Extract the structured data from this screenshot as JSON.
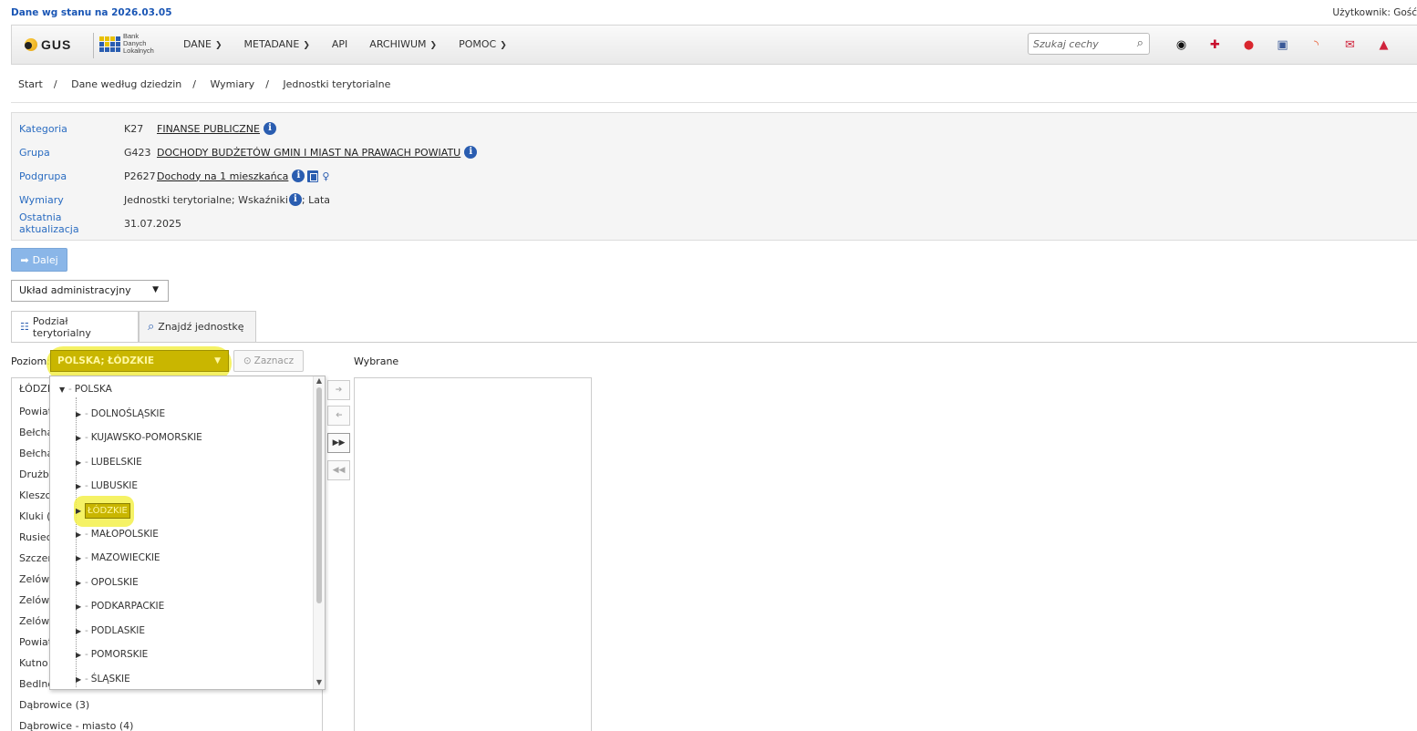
{
  "topbar": {
    "date_text": "Dane wg stanu na 2026.03.05",
    "user_text": "Użytkownik: Gość"
  },
  "logo": {
    "gus": "GUS",
    "bdl_lines": [
      "Bank",
      "Danych",
      "Lokalnych"
    ]
  },
  "nav": {
    "menu": [
      {
        "label": "DANE",
        "dropdown": true
      },
      {
        "label": "METADANE",
        "dropdown": true
      },
      {
        "label": "API",
        "dropdown": false
      },
      {
        "label": "ARCHIWUM",
        "dropdown": true
      },
      {
        "label": "POMOC",
        "dropdown": true
      }
    ],
    "search_placeholder": "Szukaj cechy",
    "icons": [
      "eye-icon",
      "flag-uk-icon",
      "chat-icon",
      "facebook-icon",
      "rss-icon",
      "mail-icon",
      "lock-icon"
    ],
    "icon_colors": [
      "#111111",
      "#c8102e",
      "#d9262e",
      "#3b5998",
      "#e8562a",
      "#d0233c",
      "#d0233c"
    ]
  },
  "breadcrumb": [
    "Start",
    "Dane według dziedzin",
    "Wymiary",
    "Jednostki terytorialne"
  ],
  "info": {
    "kategoria": {
      "label": "Kategoria",
      "code": "K27",
      "value": "FINANSE PUBLICZNE"
    },
    "grupa": {
      "label": "Grupa",
      "code": "G423",
      "value": "DOCHODY BUDŻETÓW GMIN I MIAST NA PRAWACH POWIATU"
    },
    "podgrupa": {
      "label": "Podgrupa",
      "code": "P2627",
      "value": "Dochody na 1 mieszkańca"
    },
    "wymiary": {
      "label": "Wymiary",
      "value_before": "Jednostki terytorialne; Wskaźniki",
      "value_after": "; Lata"
    },
    "aktualizacja": {
      "label": "Ostatnia aktualizacja",
      "value": "31.07.2025"
    }
  },
  "actions": {
    "dalej_label": "Dalej",
    "uklad_select": "Układ administracyjny"
  },
  "tabs": [
    {
      "label": "Podział terytorialny",
      "active": true
    },
    {
      "label": "Znajdź jednostkę",
      "active": false
    }
  ],
  "poziom": {
    "label": "Poziom:",
    "value": "POLSKA; ŁÓDZKIE",
    "zaznacz_label": "Zaznacz",
    "wybrane_label": "Wybrane"
  },
  "left_list": [
    "ŁÓDZK",
    "Powiat",
    "Bełcha",
    "Bełcha",
    "Drużbi",
    "Kleszc",
    "Kluki (",
    "Rusiec",
    "Szczerc",
    "Zelów",
    "Zelów",
    "Zelów",
    "Powiat",
    "Kutno",
    "Bedlno",
    "Dąbrowice (3)",
    "Dąbrowice - miasto (4)"
  ],
  "tree": {
    "root": "POLSKA",
    "children": [
      "DOLNOŚLĄSKIE",
      "KUJAWSKO-POMORSKIE",
      "LUBELSKIE",
      "LUBUSKIE",
      "ŁÓDZKIE",
      "MAŁOPOLSKIE",
      "MAZOWIECKIE",
      "OPOLSKIE",
      "PODKARPACKIE",
      "PODLASKIE",
      "POMORSKIE",
      "ŚLĄSKIE"
    ],
    "selected": "ŁÓDZKIE"
  },
  "colors": {
    "accent_blue": "#2a6cc1",
    "highlight_yellow": "#f3f04a",
    "selected_bg": "#c9b600"
  }
}
